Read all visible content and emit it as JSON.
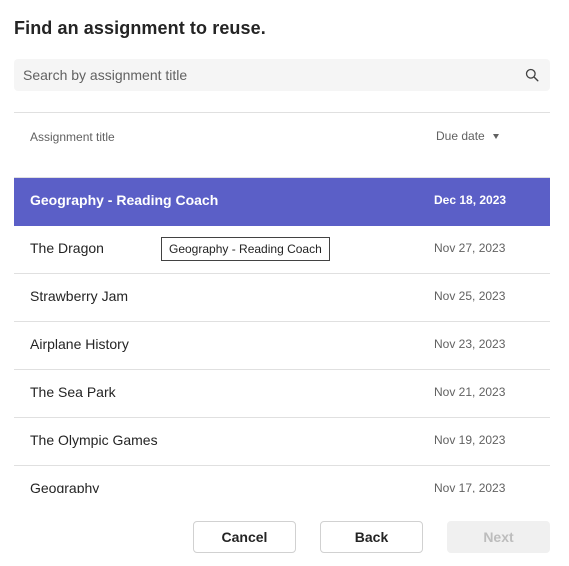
{
  "dialog": {
    "title": "Find an assignment to reuse."
  },
  "search": {
    "placeholder": "Search by assignment title",
    "value": "",
    "icon": "search-icon"
  },
  "table": {
    "columns": {
      "title": "Assignment title",
      "due": "Due date",
      "sort_icon": "sort-down-icon"
    },
    "rows": [
      {
        "title": "Geography - Reading Coach",
        "due": "Dec 18, 2023"
      },
      {
        "title": "The Dragon",
        "due": "Nov 27, 2023"
      },
      {
        "title": "Strawberry Jam",
        "due": "Nov 25, 2023"
      },
      {
        "title": "Airplane History",
        "due": "Nov 23, 2023"
      },
      {
        "title": "The Sea Park",
        "due": "Nov 21, 2023"
      },
      {
        "title": "The Olympic Games",
        "due": "Nov 19, 2023"
      },
      {
        "title": "Geography",
        "due": "Nov 17, 2023"
      }
    ],
    "selected_index": 0
  },
  "tooltip": {
    "text": "Geography - Reading Coach"
  },
  "footer": {
    "cancel_label": "Cancel",
    "back_label": "Back",
    "next_label": "Next"
  },
  "colors": {
    "accent": "#5b5fc7",
    "border": "#e0e0e0",
    "muted_text": "#616161",
    "disabled_bg": "#f0f0f0"
  }
}
